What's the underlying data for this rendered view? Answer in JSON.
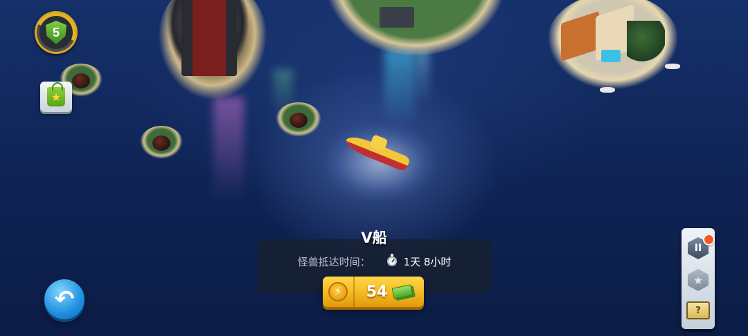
{
  "player": {
    "level": "5"
  },
  "boat": {
    "title": "V船"
  },
  "arrival": {
    "label": "怪兽抵达时间：",
    "time": "1天 8小时"
  },
  "speedup": {
    "cost": "54"
  },
  "icons": {
    "level": "shield-icon",
    "shop": "shopping-bag-icon",
    "back": "back-arrow-icon",
    "timer": "stopwatch-icon",
    "bolt": "lightning-bolt-icon",
    "cash": "cash-icon",
    "pause": "pause-icon",
    "star": "star-icon",
    "quest": "quest-book-icon"
  },
  "colors": {
    "ocean": "#102659",
    "speedup_button": "#f4b81e",
    "back_button": "#1f8fe0",
    "notification": "#f05a28"
  }
}
